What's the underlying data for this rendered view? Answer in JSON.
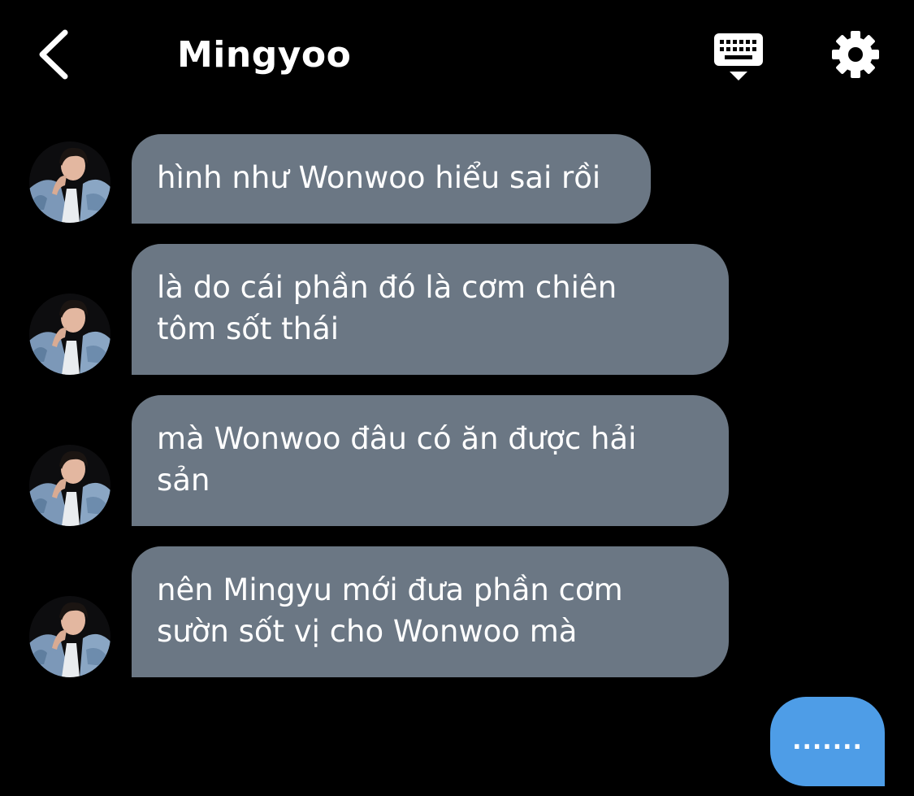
{
  "header": {
    "title": "Mingyoo",
    "back_icon": "chevron-left-icon",
    "keyboard_icon": "keyboard-icon",
    "settings_icon": "gear-icon"
  },
  "messages": [
    {
      "sender": "Mingyoo",
      "text": "hình như Wonwoo hiểu sai rồi"
    },
    {
      "sender": "Mingyoo",
      "text": "là do cái phần đó là cơm chiên\ntôm sốt thái"
    },
    {
      "sender": "Mingyoo",
      "text": "mà Wonwoo đâu có ăn được hải\nsản"
    },
    {
      "sender": "Mingyoo",
      "text": "nên Mingyu mới đưa phần cơm\nsườn sốt vị cho Wonwoo mà"
    }
  ],
  "outgoing": {
    "text": "......."
  },
  "colors": {
    "background": "#000000",
    "incoming_bubble": "#6b7784",
    "outgoing_bubble": "#4e9de7",
    "text": "#ffffff"
  }
}
